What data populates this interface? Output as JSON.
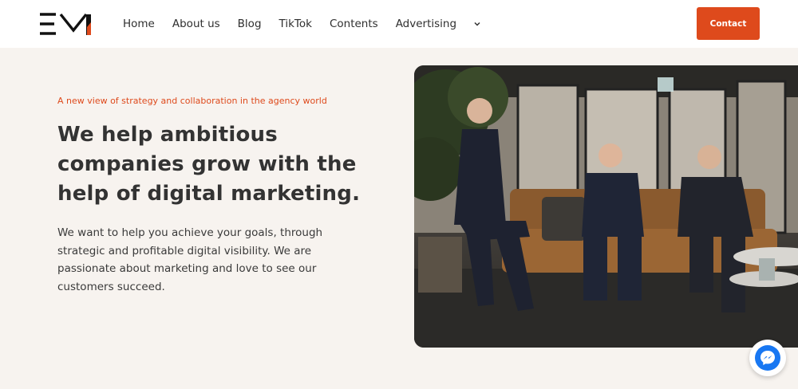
{
  "nav": {
    "items": [
      {
        "label": "Home"
      },
      {
        "label": "About us"
      },
      {
        "label": "Blog"
      },
      {
        "label": "TikTok"
      },
      {
        "label": "Contents"
      },
      {
        "label": "Advertising"
      }
    ],
    "contact_label": "Contact"
  },
  "hero": {
    "tagline": "A new view of strategy and collaboration in the agency world",
    "headline": "We help ambitious companies grow with the help of digital marketing.",
    "body": "We want to help you achieve your goals, through strategic and profitable digital visibility. We are passionate about marketing and love to see our customers succeed."
  },
  "colors": {
    "accent": "#de4a1c",
    "background": "#f7f3ef",
    "messenger": "#1877f2"
  },
  "icons": {
    "logo": "logo-icon",
    "dropdown": "chevron-down-icon",
    "chat": "messenger-icon"
  }
}
